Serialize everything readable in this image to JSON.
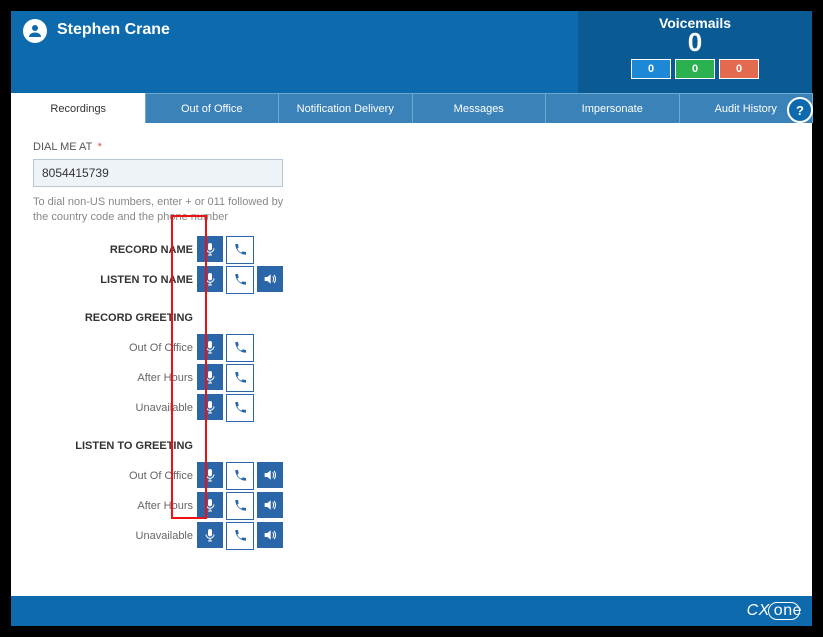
{
  "header": {
    "user_name": "Stephen Crane",
    "voicemails_label": "Voicemails",
    "voicemails_count": "0",
    "badges": {
      "blue": "0",
      "green": "0",
      "red": "0"
    }
  },
  "tabs": {
    "recordings": "Recordings",
    "out_of_office": "Out of Office",
    "notification_delivery": "Notification Delivery",
    "messages": "Messages",
    "impersonate": "Impersonate",
    "audit_history": "Audit History"
  },
  "help_glyph": "?",
  "form": {
    "dial_label": "DIAL ME AT",
    "required_mark": "*",
    "dial_value": "8054415739",
    "dial_hint": "To dial non-US numbers, enter + or 011 followed by the country code and the phone number"
  },
  "rows": {
    "record_name": "RECORD NAME",
    "listen_to_name": "LISTEN TO NAME",
    "record_greeting": "RECORD GREETING",
    "listen_to_greeting": "LISTEN TO GREETING",
    "out_of_office": "Out Of Office",
    "after_hours": "After Hours",
    "unavailable": "Unavailable"
  },
  "footer": {
    "brand_cx": "CX",
    "brand_one": "one"
  }
}
